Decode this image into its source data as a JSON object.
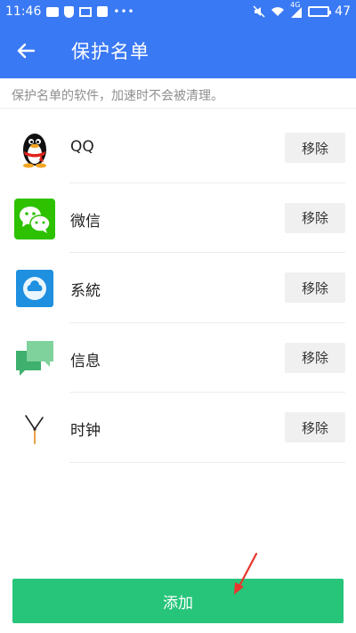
{
  "status_bar": {
    "time": "11:46",
    "network": "4G",
    "battery": "47"
  },
  "header": {
    "title": "保护名单",
    "back_icon": "arrow-left-icon"
  },
  "hint": "保护名单的软件，加速时不会被清理。",
  "apps": [
    {
      "name": "QQ",
      "icon": "qq-penguin-icon",
      "action": "移除"
    },
    {
      "name": "微信",
      "icon": "wechat-icon",
      "action": "移除"
    },
    {
      "name": "系統",
      "icon": "system-cloud-icon",
      "action": "移除"
    },
    {
      "name": "信息",
      "icon": "message-bubbles-icon",
      "action": "移除"
    },
    {
      "name": "时钟",
      "icon": "clock-hands-icon",
      "action": "移除"
    }
  ],
  "add_button": "添加",
  "colors": {
    "primary": "#3a79f4",
    "add_green": "#27c57a",
    "remove_bg": "#f0f0f0",
    "wechat_green": "#2dc100",
    "arrow_red": "#e8362d"
  }
}
